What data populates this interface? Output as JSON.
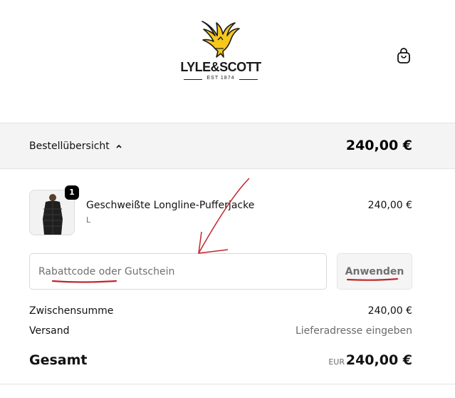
{
  "brand": {
    "name": "LYLE&SCOTT",
    "tagline": "EST 1874",
    "accent": "#f6c81b"
  },
  "header": {
    "cart_icon": "shopping-bag-icon"
  },
  "summary": {
    "toggle_label": "Bestellübersicht",
    "toggle_icon": "chevron-up-icon",
    "total": "240,00 €"
  },
  "cart": {
    "items": [
      {
        "name": "Geschweißte Longline-Pufferjacke",
        "variant": "L",
        "quantity": "1",
        "price": "240,00 €"
      }
    ]
  },
  "discount": {
    "placeholder": "Rabattcode oder Gutschein",
    "apply_label": "Anwenden"
  },
  "totals": {
    "subtotal_label": "Zwischensumme",
    "subtotal_value": "240,00 €",
    "shipping_label": "Versand",
    "shipping_value": "Lieferadresse eingeben",
    "total_label": "Gesamt",
    "currency": "EUR",
    "total_value": "240,00 €"
  },
  "colors": {
    "annotation_red": "#c0272d",
    "summary_bg": "#f4f4f4"
  }
}
